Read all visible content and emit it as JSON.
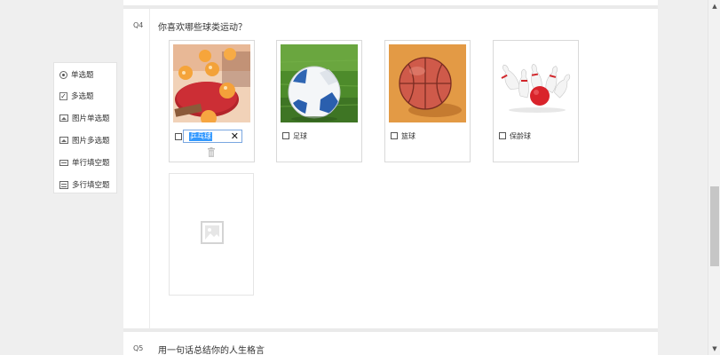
{
  "palette": {
    "items": [
      {
        "label": "单选题",
        "icon": "radio-icon"
      },
      {
        "label": "多选题",
        "icon": "checkbox-icon"
      },
      {
        "label": "图片单选题",
        "icon": "image-icon"
      },
      {
        "label": "图片多选题",
        "icon": "image-icon"
      },
      {
        "label": "单行填空题",
        "icon": "single-line-icon"
      },
      {
        "label": "多行填空题",
        "icon": "multi-line-icon"
      }
    ],
    "checkmark": "✓"
  },
  "question4": {
    "number": "Q4",
    "title": "你喜欢哪些球类运动？",
    "options": [
      {
        "label": "乒乓球",
        "editing": true,
        "clear_icon": "✕"
      },
      {
        "label": "足球"
      },
      {
        "label": "篮球"
      },
      {
        "label": "保龄球"
      }
    ]
  },
  "question5": {
    "number": "Q5",
    "title": "用一句话总结你的人生格言"
  },
  "scrollbar": {
    "up": "▲",
    "down": "▼"
  },
  "colors": {
    "background": "#efefef",
    "selection": "#3399ff",
    "edit_border": "#7aa7e0"
  }
}
